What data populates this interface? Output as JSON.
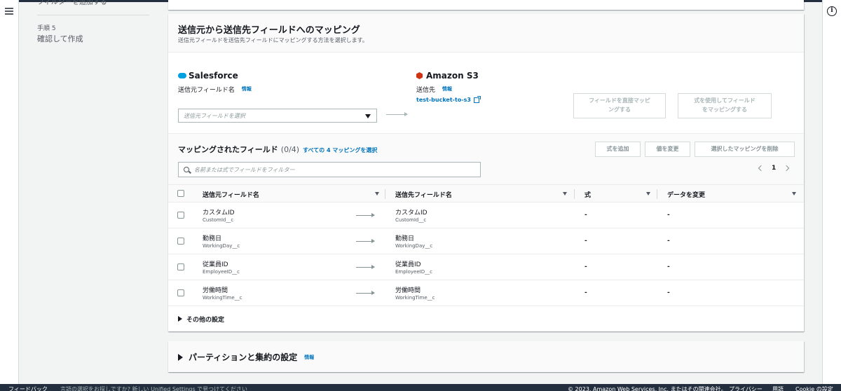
{
  "nav": {
    "clipped_item": "フィルターを追加する",
    "step_label": "手順 5",
    "step_title": "確認して作成"
  },
  "mapping_section": {
    "title": "送信元から送信先フィールドへのマッピング",
    "description": "送信元フィールドを送信先フィールドにマッピングする方法を選択します。",
    "source": {
      "connector": "Salesforce",
      "field_label": "送信元フィールド名",
      "info": "情報",
      "placeholder": "送信元フィールドを選択"
    },
    "destination": {
      "connector": "Amazon S3",
      "field_label": "送信先",
      "info": "情報",
      "bucket": "test-bucket-to-s3"
    },
    "buttons": {
      "direct_map_line1": "フィールドを直接マッピ",
      "direct_map_line2": "ングする",
      "formula_map_line1": "式を使用してフィールド",
      "formula_map_line2": "をマッピングする"
    }
  },
  "mapped_fields": {
    "title": "マッピングされたフィールド",
    "count": "(0/4)",
    "select_all": "すべての 4 マッピングを選択",
    "add_formula": "式を追加",
    "change_value": "値を変更",
    "delete_selected": "選択したマッピングを削除",
    "filter_placeholder": "名前または式でフィールドをフィルター",
    "page": "1",
    "columns": {
      "source": "送信元フィールド名",
      "destination": "送信先フィールド名",
      "formula": "式",
      "modify_data": "データを変更"
    },
    "rows": [
      {
        "source_name": "カスタムID",
        "source_api": "CustomId__c",
        "dest_name": "カスタムID",
        "dest_api": "CustomId__c",
        "formula": "-",
        "modify": "-"
      },
      {
        "source_name": "勤務日",
        "source_api": "WorkingDay__c",
        "dest_name": "勤務日",
        "dest_api": "WorkingDay__c",
        "formula": "-",
        "modify": "-"
      },
      {
        "source_name": "従業員ID",
        "source_api": "EmployeeID__c",
        "dest_name": "従業員ID",
        "dest_api": "EmployeeID__c",
        "formula": "-",
        "modify": "-"
      },
      {
        "source_name": "労働時間",
        "source_api": "WorkingTime__c",
        "dest_name": "労働時間",
        "dest_api": "WorkingTime__c",
        "formula": "-",
        "modify": "-"
      }
    ],
    "more_settings": "その他の設定"
  },
  "partition": {
    "title": "パーティションと集約の設定",
    "info": "情報"
  },
  "footer": {
    "feedback": "フィードバック",
    "notice": "言語の選択をお探しですか? 新しい Unified Settings で見つけてください",
    "copyright": "© 2023, Amazon Web Services, Inc. またはその関連会社。",
    "privacy": "プライバシー",
    "terms": "用語",
    "cookie": "Cookie の設定"
  },
  "colors": {
    "link": "#0073bb",
    "salesforce": "#00a1e0",
    "s3": "#d13212",
    "footer_bg": "#232f3e"
  }
}
